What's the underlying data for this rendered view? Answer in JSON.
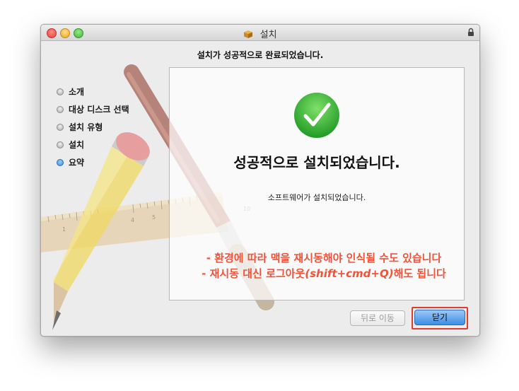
{
  "window": {
    "title": "설치"
  },
  "header": {
    "text": "설치가 성공적으로 완료되었습니다."
  },
  "sidebar": {
    "steps": [
      {
        "label": "소개",
        "active": false
      },
      {
        "label": "대상 디스크 선택",
        "active": false
      },
      {
        "label": "설치 유형",
        "active": false
      },
      {
        "label": "설치",
        "active": false
      },
      {
        "label": "요약",
        "active": true
      }
    ]
  },
  "main": {
    "title": "성공적으로 설치되었습니다.",
    "subtitle": "소프트웨어가 설치되었습니다.",
    "note1": "- 환경에 따라 맥을 재시동해야 인식될 수도 있습니다",
    "note2_a": "- 재시동 대신 로그아웃",
    "note2_b": "(shift+cmd+Q)",
    "note2_c": "해도 됩니다",
    "ruler_marks": [
      "1",
      "4",
      "5",
      "10"
    ]
  },
  "buttons": {
    "back": "뒤로 이동",
    "close": "닫기"
  },
  "colors": {
    "note": "#f0533a",
    "check": "#2fb52f",
    "accent": "#3c8ee5",
    "highlight": "#e03b30"
  },
  "icons": [
    "package-icon",
    "lock-icon",
    "checkmark-icon",
    "pencil-icon",
    "brush-icon",
    "ruler-icon"
  ]
}
